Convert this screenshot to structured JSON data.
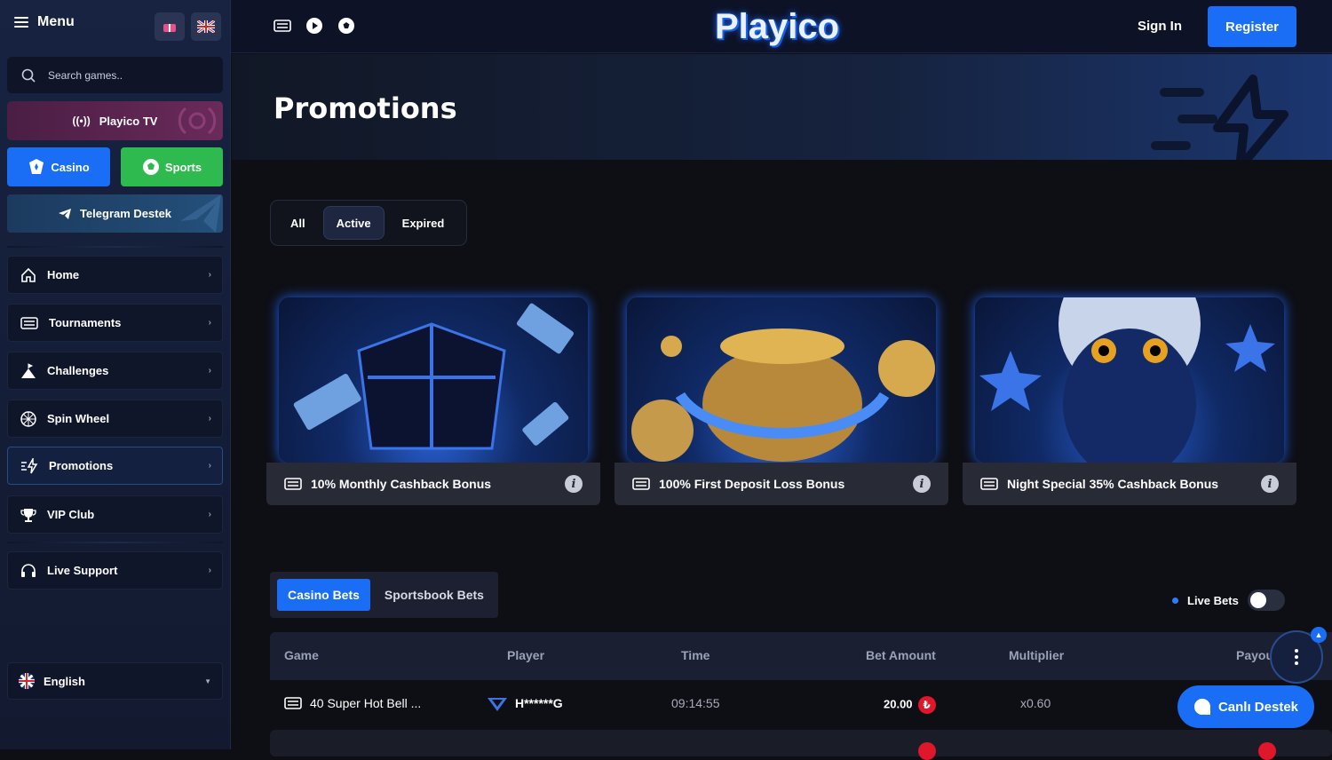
{
  "sidebar": {
    "menu_label": "Menu",
    "search_placeholder": "Search games..",
    "tv_label": "Playico TV",
    "casino_label": "Casino",
    "sports_label": "Sports",
    "telegram_label": "Telegram Destek",
    "items": [
      {
        "label": "Home",
        "icon": "home-icon"
      },
      {
        "label": "Tournaments",
        "icon": "trophy-grid-icon"
      },
      {
        "label": "Challenges",
        "icon": "mountain-flag-icon"
      },
      {
        "label": "Spin Wheel",
        "icon": "wheel-icon"
      },
      {
        "label": "Promotions",
        "icon": "lightning-icon"
      },
      {
        "label": "VIP Club",
        "icon": "trophy-icon"
      },
      {
        "label": "Live Support",
        "icon": "headset-icon"
      }
    ],
    "language": "English"
  },
  "header": {
    "logo": "Playico",
    "signin": "Sign In",
    "register": "Register"
  },
  "hero": {
    "title": "Promotions"
  },
  "filters": {
    "all": "All",
    "active": "Active",
    "expired": "Expired"
  },
  "promos": [
    {
      "title": "10% Monthly Cashback Bonus"
    },
    {
      "title": "100% First Deposit Loss Bonus"
    },
    {
      "title": "Night Special 35% Cashback Bonus"
    }
  ],
  "bets": {
    "tab_casino": "Casino Bets",
    "tab_sports": "Sportsbook Bets",
    "live_label": "Live Bets",
    "columns": [
      "Game",
      "Player",
      "Time",
      "Bet Amount",
      "Multiplier",
      "Payou"
    ],
    "rows": [
      {
        "game": "40 Super Hot Bell ...",
        "player": "H******G",
        "time": "09:14:55",
        "amount": "20.00",
        "multiplier": "x0.60"
      }
    ]
  },
  "chat": {
    "label": "Canlı Destek"
  },
  "colors": {
    "accent": "#1a6ef5",
    "sports": "#2fba4f",
    "currency": "#e0162b"
  }
}
